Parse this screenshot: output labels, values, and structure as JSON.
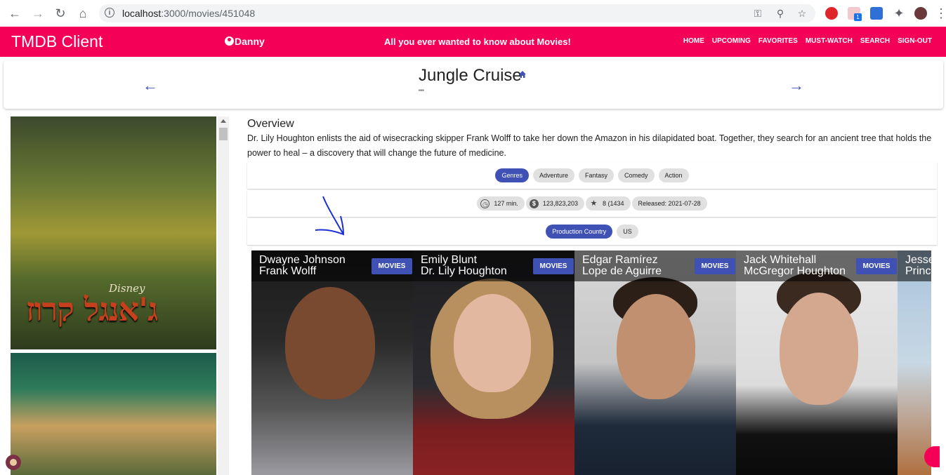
{
  "browser": {
    "url_host": "localhost",
    "url_path": ":3000/movies/451048",
    "extension_badge": "1"
  },
  "appbar": {
    "brand": "TMDB Client",
    "user": "Danny",
    "tagline": "All you ever wanted to know about Movies!",
    "menu": [
      "HOME",
      "UPCOMING",
      "FAVORITES",
      "MUST-WATCH",
      "SEARCH",
      "SIGN-OUT"
    ],
    "color": "#f50057"
  },
  "movie": {
    "title": "Jungle Cruise",
    "tagline": "\"\"",
    "poster_text": "ג'אנגל קרוז",
    "poster_brand": "Disney",
    "overview_label": "Overview",
    "overview": "Dr. Lily Houghton enlists the aid of wisecracking skipper Frank Wolff to take her down the Amazon in his dilapidated boat. Together, they search for an ancient tree that holds the power to heal – a discovery that will change the future of medicine.",
    "genres_label": "Genres",
    "genres": [
      "Adventure",
      "Fantasy",
      "Comedy",
      "Action"
    ],
    "runtime": "127 min.",
    "revenue": "123,823,203",
    "rating": "8 (1434",
    "released": "Released: 2021-07-28",
    "production_country_label": "Production Country",
    "production_country": "US"
  },
  "cast": [
    {
      "actor": "Dwayne Johnson",
      "role": "Frank Wolff",
      "button": "MOVIES"
    },
    {
      "actor": "Emily Blunt",
      "role": "Dr. Lily Houghton",
      "button": "MOVIES"
    },
    {
      "actor": "Edgar Ramírez",
      "role": "Lope de Aguirre",
      "button": "MOVIES"
    },
    {
      "actor": "Jack Whitehall",
      "role": "McGregor Houghton",
      "button": "MOVIES"
    },
    {
      "actor": "Jesse",
      "role": "Princ",
      "button": ""
    }
  ],
  "accent": "#3f51b5"
}
